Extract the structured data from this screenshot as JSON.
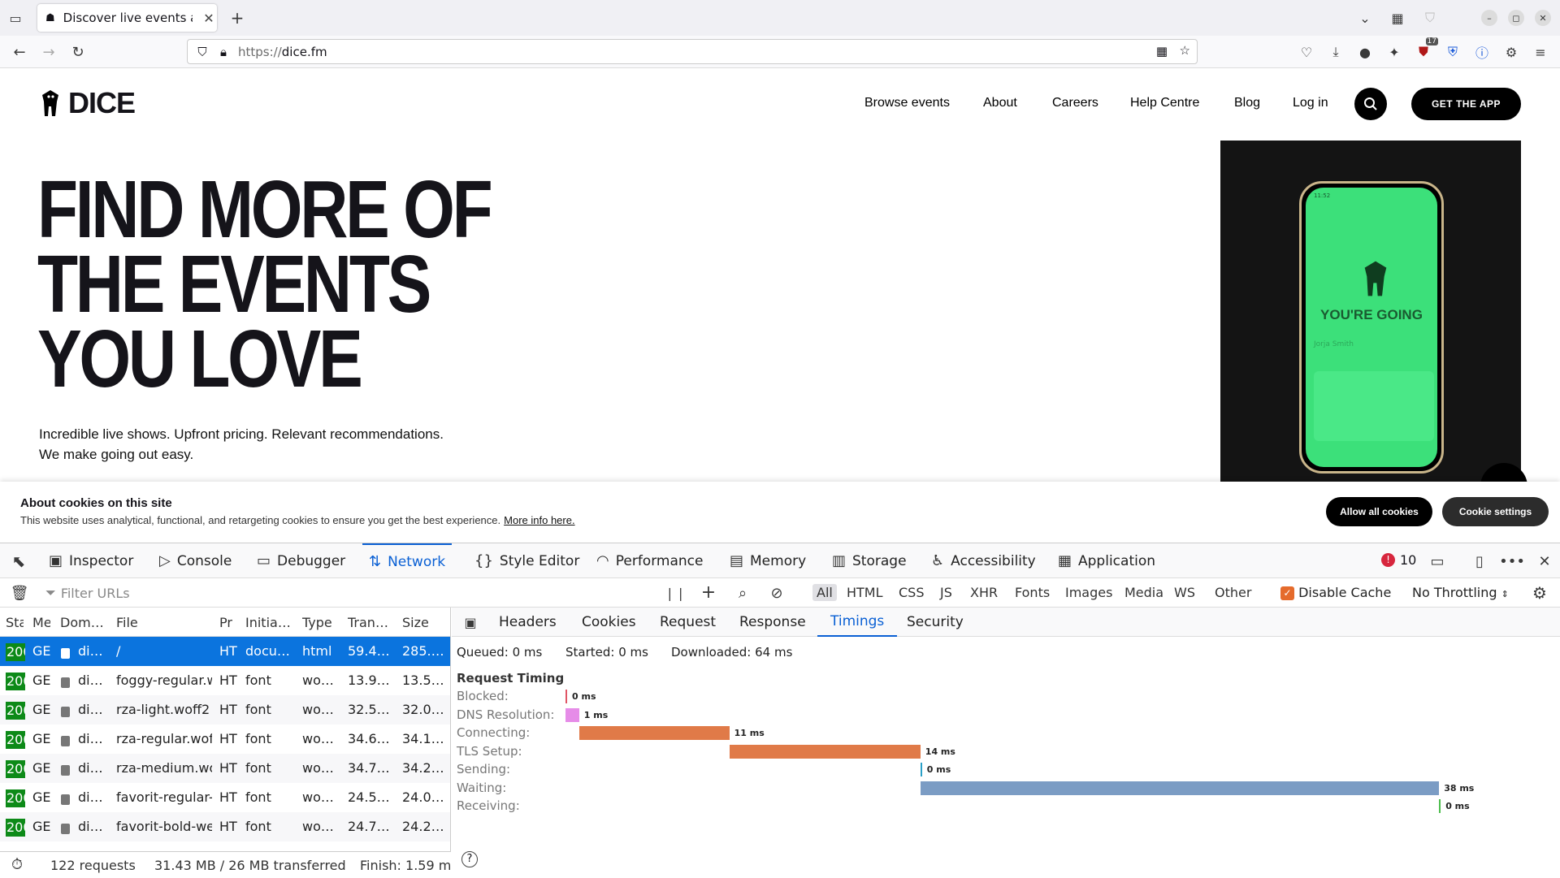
{
  "browser": {
    "tab_title": "Discover live events and ticke",
    "url_scheme": "https://",
    "url_host": "dice.fm",
    "extension_badge": "17"
  },
  "site": {
    "logo_text": "DICE",
    "nav": [
      "Browse events",
      "About",
      "Careers",
      "Help Centre",
      "Blog",
      "Log in"
    ],
    "get_app": "GET THE APP",
    "hero_lines": [
      "FIND MORE OF",
      "THE EVENTS",
      "YOU LOVE"
    ],
    "subtitle_1": "Incredible live shows. Upfront pricing. Relevant recommendations.",
    "subtitle_2": "We make going out easy.",
    "phone_time": "11:52",
    "phone_going": "YOU'RE GOING",
    "phone_name": "Jorja Smith"
  },
  "cookie": {
    "title": "About cookies on this site",
    "text": "This website uses analytical, functional, and retargeting cookies to ensure you get the best experience.",
    "more": "More info here.",
    "allow": "Allow all cookies",
    "settings": "Cookie settings"
  },
  "devtools": {
    "tabs": [
      {
        "label": "Inspector",
        "icon": "inspector-icon"
      },
      {
        "label": "Console",
        "icon": "console-icon"
      },
      {
        "label": "Debugger",
        "icon": "debugger-icon"
      },
      {
        "label": "Network",
        "icon": "network-icon"
      },
      {
        "label": "Style Editor",
        "icon": "style-editor-icon"
      },
      {
        "label": "Performance",
        "icon": "performance-icon"
      },
      {
        "label": "Memory",
        "icon": "memory-icon"
      },
      {
        "label": "Storage",
        "icon": "storage-icon"
      },
      {
        "label": "Accessibility",
        "icon": "accessibility-icon"
      },
      {
        "label": "Application",
        "icon": "application-icon"
      }
    ],
    "error_count": "10",
    "filter_placeholder": "Filter URLs",
    "types": [
      "All",
      "HTML",
      "CSS",
      "JS",
      "XHR",
      "Fonts",
      "Images",
      "Media",
      "WS",
      "Other"
    ],
    "disable_cache": "Disable Cache",
    "throttling": "No Throttling",
    "columns": [
      "Sta",
      "Me",
      "Dom…",
      "File",
      "Pr",
      "Initia…",
      "Type",
      "Tran…",
      "Size"
    ],
    "rows": [
      {
        "status": "200",
        "method": "GET",
        "domain": "di…",
        "file": "/",
        "proto": "HT",
        "initiator": "docu…",
        "type": "html",
        "transferred": "59.4…",
        "size": "285.…"
      },
      {
        "status": "200",
        "method": "GET",
        "domain": "di…",
        "file": "foggy-regular.w",
        "proto": "HT",
        "initiator": "font",
        "type": "wo…",
        "transferred": "13.9…",
        "size": "13.5…"
      },
      {
        "status": "200",
        "method": "GET",
        "domain": "di…",
        "file": "rza-light.woff2",
        "proto": "HT",
        "initiator": "font",
        "type": "wo…",
        "transferred": "32.5…",
        "size": "32.0…"
      },
      {
        "status": "200",
        "method": "GET",
        "domain": "di…",
        "file": "rza-regular.woff",
        "proto": "HT",
        "initiator": "font",
        "type": "wo…",
        "transferred": "34.6…",
        "size": "34.1…"
      },
      {
        "status": "200",
        "method": "GET",
        "domain": "di…",
        "file": "rza-medium.wo",
        "proto": "HT",
        "initiator": "font",
        "type": "wo…",
        "transferred": "34.7…",
        "size": "34.2…"
      },
      {
        "status": "200",
        "method": "GET",
        "domain": "di…",
        "file": "favorit-regular-v",
        "proto": "HT",
        "initiator": "font",
        "type": "wo…",
        "transferred": "24.5…",
        "size": "24.0…"
      },
      {
        "status": "200",
        "method": "GET",
        "domain": "di…",
        "file": "favorit-bold-wel",
        "proto": "HT",
        "initiator": "font",
        "type": "wo…",
        "transferred": "24.7…",
        "size": "24.2…"
      }
    ],
    "summary": {
      "requests": "122 requests",
      "transferred": "31.43 MB / 26 MB transferred",
      "finish": "Finish: 1.59 min"
    },
    "detail_tabs": [
      "Headers",
      "Cookies",
      "Request",
      "Response",
      "Timings",
      "Security"
    ],
    "queued": "Queued: 0 ms",
    "started": "Started: 0 ms",
    "downloaded": "Downloaded: 64 ms",
    "request_timing_title": "Request Timing",
    "timings": [
      {
        "label": "Blocked:",
        "ms": 0,
        "value": "0 ms",
        "color": "#e05565"
      },
      {
        "label": "DNS Resolution:",
        "ms": 1,
        "value": "1 ms",
        "color": "#e68ce8"
      },
      {
        "label": "Connecting:",
        "ms": 11,
        "value": "11 ms",
        "color": "#e07a48"
      },
      {
        "label": "TLS Setup:",
        "ms": 14,
        "value": "14 ms",
        "color": "#e07a48"
      },
      {
        "label": "Sending:",
        "ms": 0,
        "value": "0 ms",
        "color": "#2aa0c8"
      },
      {
        "label": "Waiting:",
        "ms": 38,
        "value": "38 ms",
        "color": "#7b9cc4"
      },
      {
        "label": "Receiving:",
        "ms": 0,
        "value": "0 ms",
        "color": "#4cbd4c"
      }
    ]
  }
}
